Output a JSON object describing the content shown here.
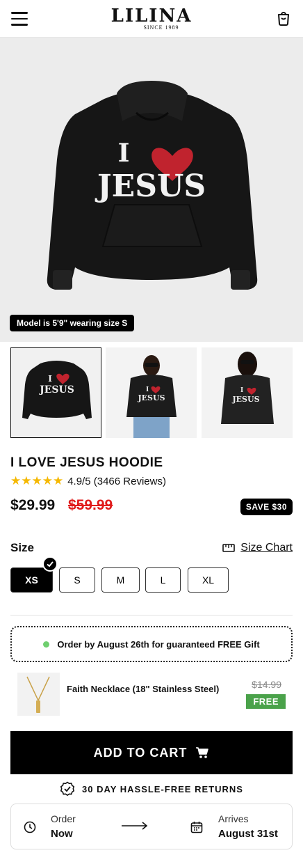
{
  "header": {
    "logo": "LILINA",
    "logo_sub": "SINCE 1989"
  },
  "hero": {
    "print_line1": "I",
    "print_line2": "JESUS",
    "model_note": "Model is 5'9\" wearing size S"
  },
  "product": {
    "title": "I LOVE JESUS HOODIE",
    "stars": "★★★★★",
    "rating_text": "4.9/5 (3466 Reviews)",
    "price": "$29.99",
    "old_price": "$59.99",
    "save_badge": "SAVE $30"
  },
  "size": {
    "label": "Size",
    "chart_label": "Size Chart",
    "options": [
      "XS",
      "S",
      "M",
      "L",
      "XL"
    ],
    "selected": "XS"
  },
  "gift": {
    "banner": "Order by August 26th for guaranteed FREE Gift",
    "item_name": "Faith Necklace (18\" Stainless Steel)",
    "old_price": "$14.99",
    "free_label": "FREE"
  },
  "cta": {
    "add_to_cart": "ADD TO CART",
    "returns": "30 DAY HASSLE-FREE RETURNS"
  },
  "delivery": {
    "order_label": "Order",
    "order_value": "Now",
    "arrives_label": "Arrives",
    "arrives_value": "August 31st"
  },
  "colors": {
    "heart_red": "#c0232e",
    "sale_red": "#e01b1b",
    "free_green": "#4aa24a",
    "star_gold": "#f5b800"
  },
  "icons": [
    "menu-icon",
    "bag-icon",
    "ruler-icon",
    "check-icon",
    "cart-icon",
    "badge-check-icon",
    "clock-icon",
    "arrow-right-icon",
    "calendar-icon"
  ]
}
